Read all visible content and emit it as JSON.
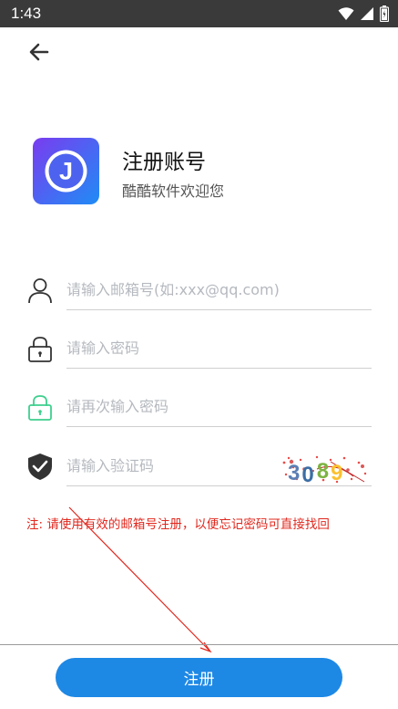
{
  "status_bar": {
    "time": "1:43"
  },
  "header": {
    "back_icon": "arrow-left-icon"
  },
  "app": {
    "logo_letter": "J",
    "title": "注册账号",
    "subtitle": "酷酷软件欢迎您"
  },
  "form": {
    "email": {
      "placeholder": "请输入邮箱号(如:xxx@qq.com)",
      "value": "",
      "icon": "user-icon"
    },
    "password": {
      "placeholder": "请输入密码",
      "value": "",
      "icon": "lock-icon"
    },
    "confirm_password": {
      "placeholder": "请再次输入密码",
      "value": "",
      "icon": "lock-icon",
      "icon_color": "#3ecf8e"
    },
    "captcha": {
      "placeholder": "请输入验证码",
      "value": "",
      "icon": "shield-check-icon",
      "captcha_text": "3089"
    }
  },
  "note": "注: 请使用有效的邮箱号注册，以便忘记密码可直接找回",
  "register_button": {
    "label": "注册"
  },
  "colors": {
    "status_bar": "#3a3a3a",
    "primary": "#1e88e5",
    "note": "#e0281e",
    "logo_gradient_start": "#7a3cf0",
    "logo_gradient_end": "#1f8cf5"
  }
}
